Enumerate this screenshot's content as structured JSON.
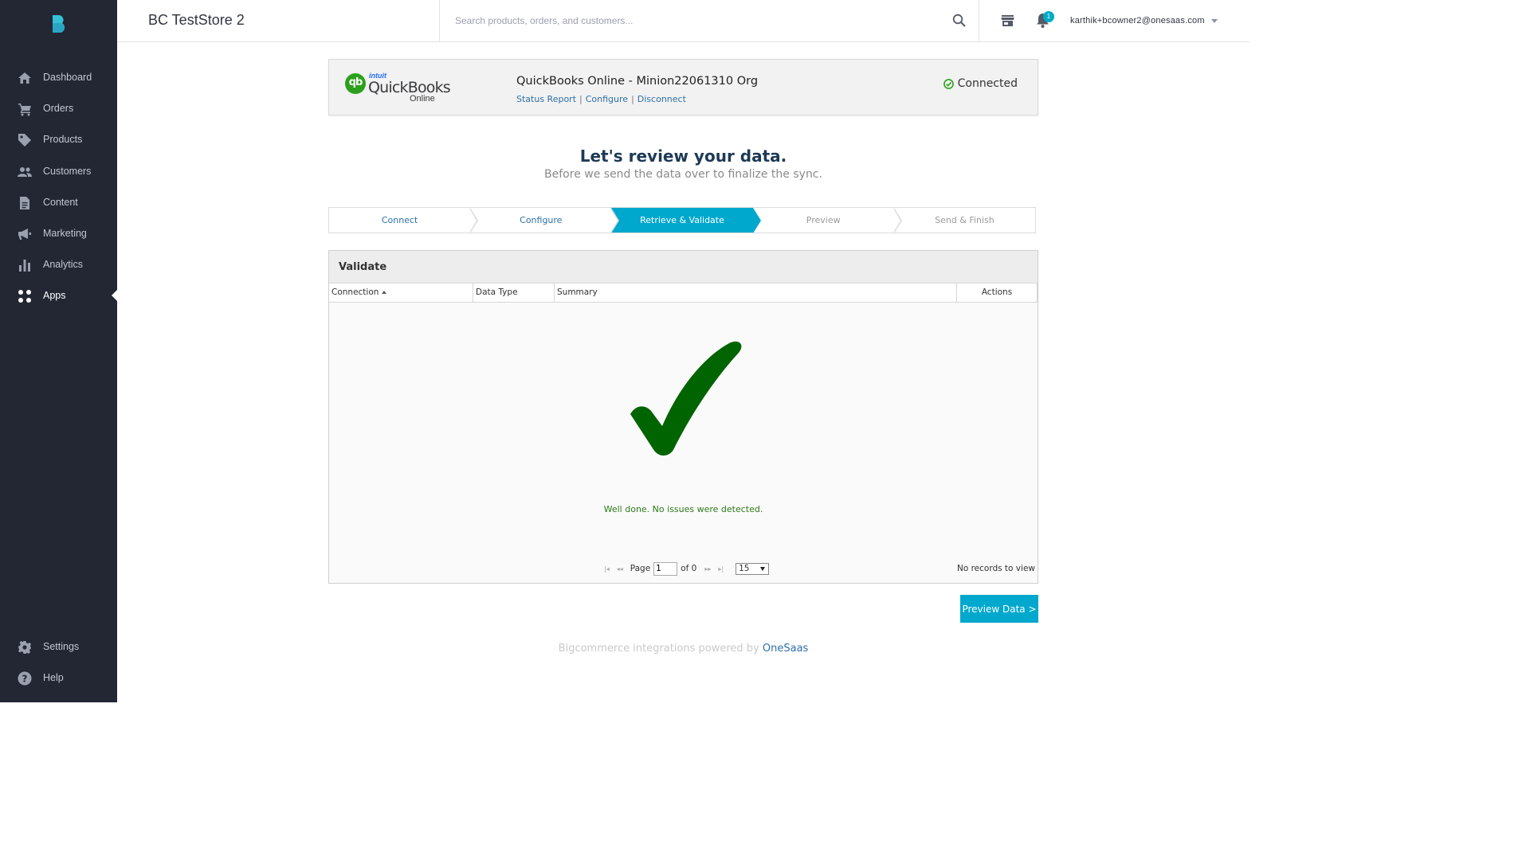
{
  "app": {
    "store_name": "BC TestStore 2"
  },
  "header": {
    "search_placeholder": "Search products, orders, and customers...",
    "notification_count": "1",
    "user_email": "karthik+bcowner2@onesaas.com"
  },
  "sidebar": {
    "items": [
      {
        "label": "Dashboard",
        "icon": "home-icon"
      },
      {
        "label": "Orders",
        "icon": "cart-icon"
      },
      {
        "label": "Products",
        "icon": "tag-icon"
      },
      {
        "label": "Customers",
        "icon": "people-icon"
      },
      {
        "label": "Content",
        "icon": "document-icon"
      },
      {
        "label": "Marketing",
        "icon": "megaphone-icon"
      },
      {
        "label": "Analytics",
        "icon": "bar-chart-icon"
      },
      {
        "label": "Apps",
        "icon": "apps-grid-icon",
        "active": true
      }
    ],
    "bottom_items": [
      {
        "label": "Settings",
        "icon": "gear-icon"
      },
      {
        "label": "Help",
        "icon": "help-icon"
      }
    ]
  },
  "connection": {
    "logo_intuit": "intuit",
    "logo_name": "QuickBooks",
    "logo_sub": "Online",
    "title": "QuickBooks Online - Minion22061310 Org",
    "links": [
      "Status Report",
      "Configure",
      "Disconnect"
    ],
    "status": "Connected"
  },
  "review": {
    "title": "Let's review your data.",
    "subtitle": "Before we send the data over to finalize the sync."
  },
  "steps": [
    "Connect",
    "Configure",
    "Retrieve & Validate",
    "Preview",
    "Send & Finish"
  ],
  "active_step": 2,
  "validate": {
    "title": "Validate",
    "columns": [
      "Connection",
      "Data Type",
      "Summary",
      "Actions"
    ],
    "message": "Well done. No issues were detected.",
    "pager": {
      "page_label": "Page",
      "page_value": "1",
      "of_label": "of 0",
      "page_size": "15",
      "records_text": "No records to view"
    }
  },
  "preview_button": "Preview Data >",
  "footer": {
    "text": "Bigcommerce integrations powered by ",
    "link": "OneSaas"
  },
  "colors": {
    "sidebar": "#232734",
    "accent": "#00a8cd",
    "success": "#006400",
    "link": "#2d6fa8"
  }
}
